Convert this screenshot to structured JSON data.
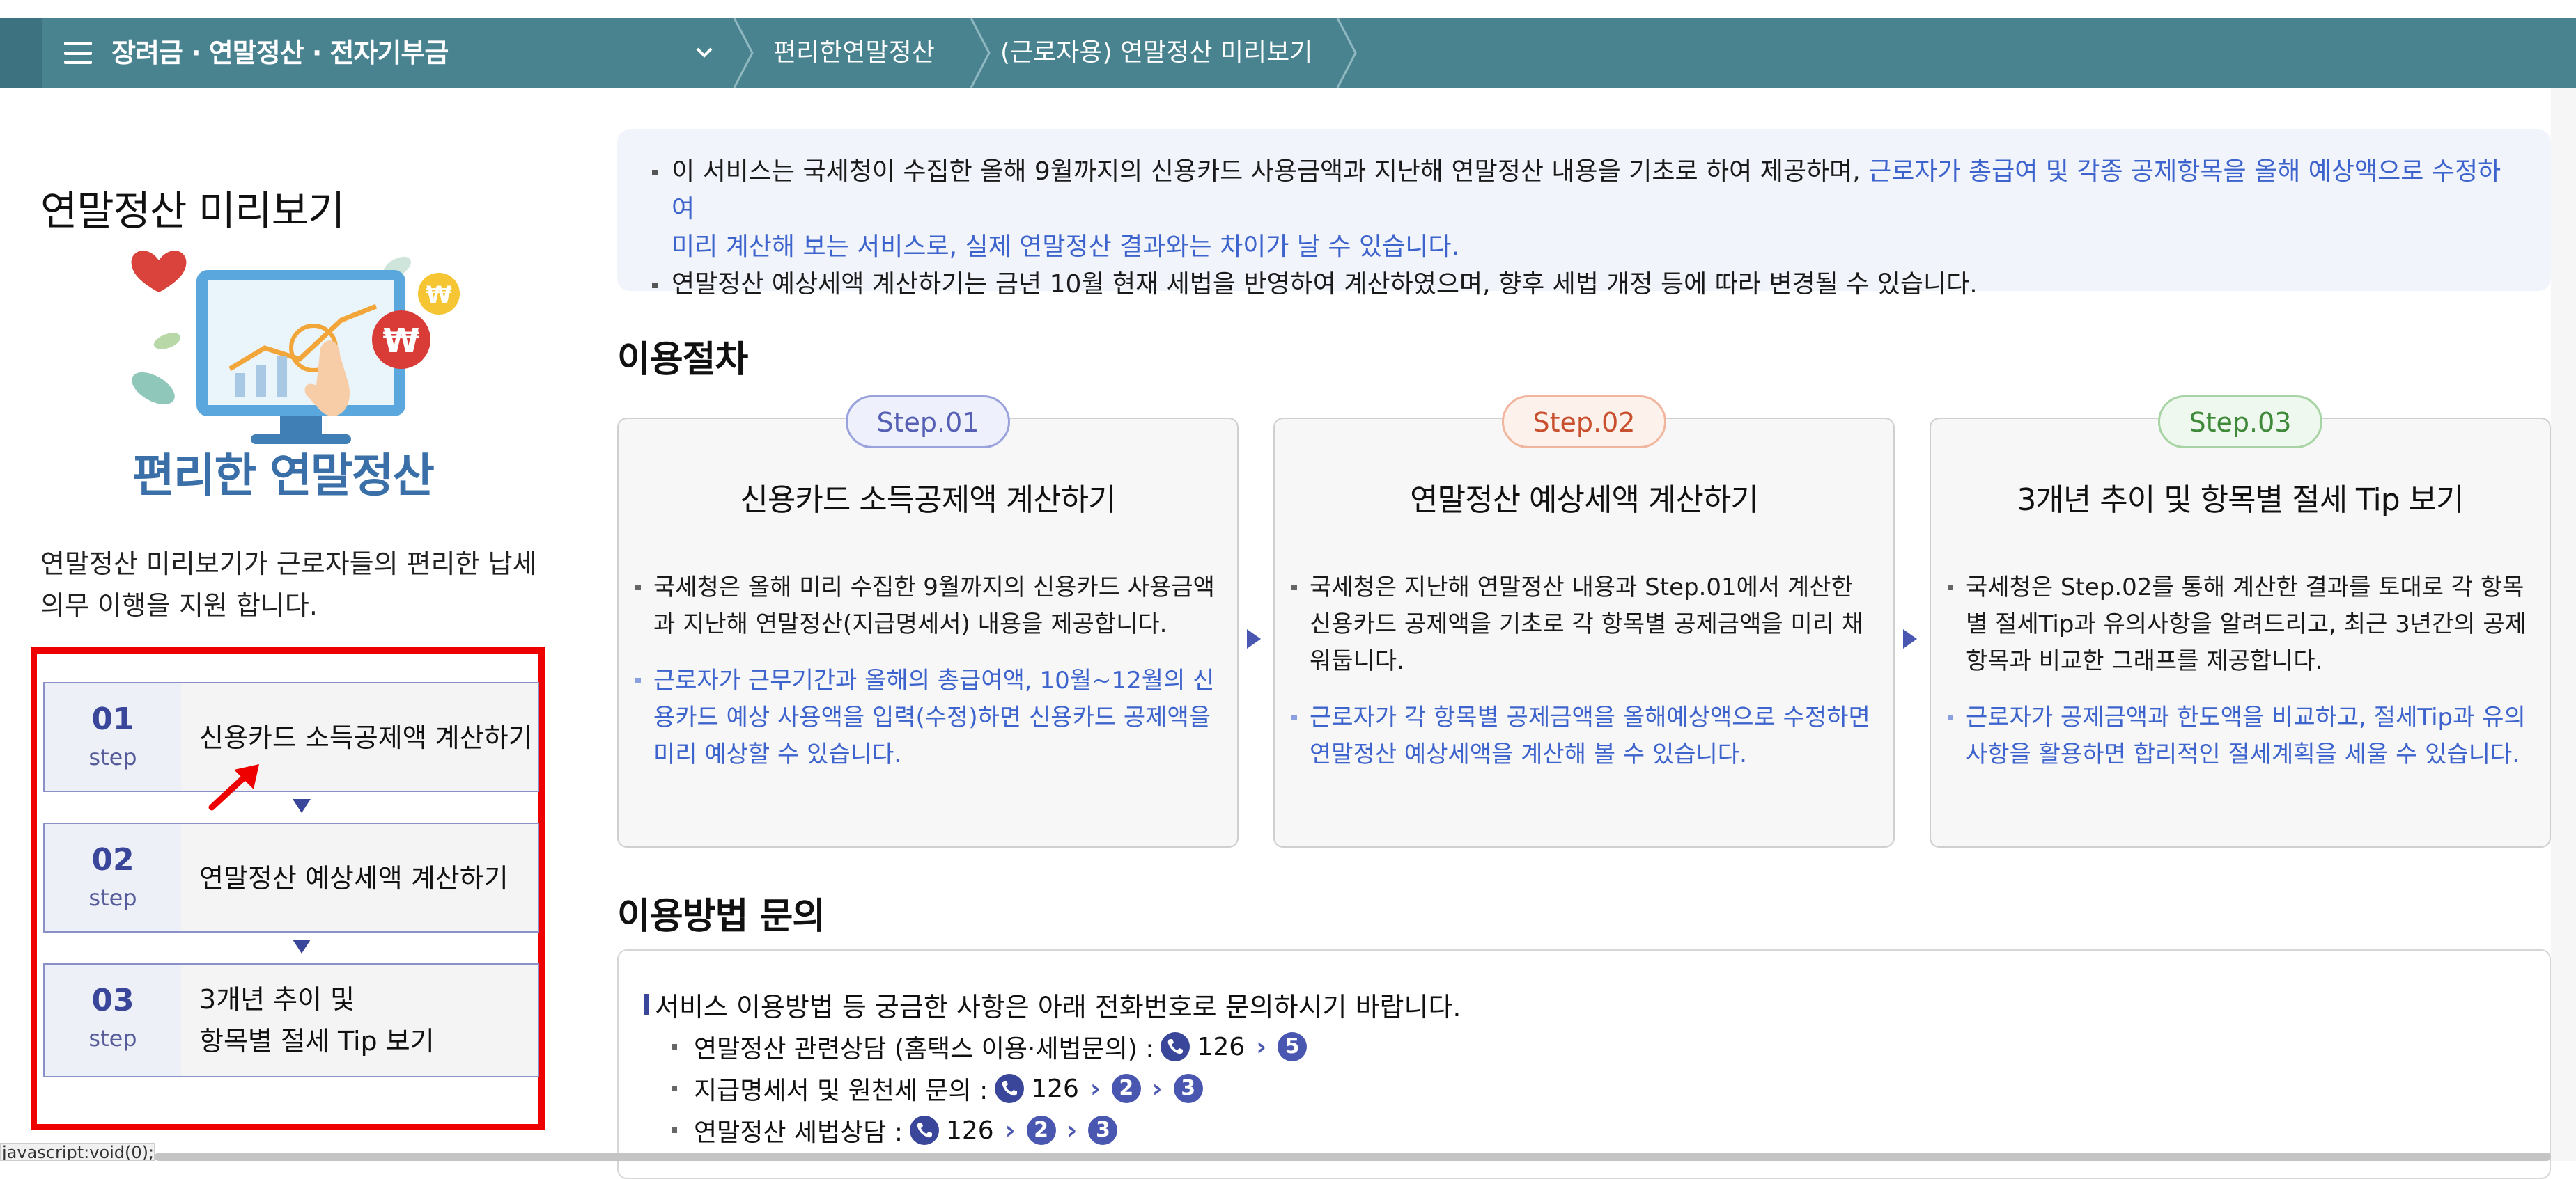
{
  "breadcrumb": {
    "level1": "장려금 · 연말정산 · 전자기부금",
    "level2": "편리한연말정산",
    "level3": "(근로자용) 연말정산 미리보기"
  },
  "left": {
    "title": "연말정산 미리보기",
    "illustration_caption": "편리한 연말정산",
    "description": "연말정산 미리보기가 근로자들의  편리한 납세 의무 이행을 지원 합니다.",
    "steps": [
      {
        "num": "01",
        "word": "step",
        "label": "신용카드 소득공제액 계산하기"
      },
      {
        "num": "02",
        "word": "step",
        "label": "연말정산 예상세액 계산하기"
      },
      {
        "num": "03",
        "word": "step",
        "label_line1": "3개년 추이 및",
        "label_line2": "항목별 절세 Tip 보기"
      }
    ]
  },
  "notice": {
    "line1_black": "이 서비스는 국세청이 수집한 올해 9월까지의 신용카드 사용금액과 지난해 연말정산 내용을 기초로 하여 제공하며, ",
    "line1_blue": "근로자가 총급여 및 각종 공제항목을 올해 예상액으로 수정하여",
    "line2_blue": "미리 계산해 보는 서비스로, 실제 연말정산 결과와는 차이가 날 수 있습니다.",
    "line3": "연말정산 예상세액 계산하기는 금년 10월 현재 세법을 반영하여 계산하였으며, 향후 세법 개정 등에 따라 변경될 수 있습니다."
  },
  "procedure": {
    "title": "이용절차",
    "cards": [
      {
        "pill": "Step.01",
        "pill_color": "#5560b5",
        "title": "신용카드 소득공제액 계산하기",
        "body_black": "국세청은 올해 미리 수집한 9월까지의 신용카드 사용금액과 지난해 연말정산(지급명세서) 내용을 제공합니다.",
        "body_blue": "근로자가 근무기간과 올해의 총급여액, 10월~12월의 신용카드 예상 사용액을 입력(수정)하면 신용카드 공제액을 미리 예상할 수 있습니다."
      },
      {
        "pill": "Step.02",
        "pill_color": "#c9502e",
        "title": "연말정산 예상세액 계산하기",
        "body_black": "국세청은 지난해 연말정산 내용과 Step.01에서 계산한 신용카드 공제액을 기초로 각 항목별 공제금액을 미리 채워둡니다.",
        "body_blue": "근로자가 각 항목별 공제금액을 올해예상액으로 수정하면 연말정산 예상세액을 계산해 볼 수 있습니다."
      },
      {
        "pill": "Step.03",
        "pill_color": "#3f8a3a",
        "title": "3개년 추이 및 항목별 절세 Tip 보기",
        "body_black": "국세청은 Step.02를 통해 계산한 결과를 토대로 각 항목별 절세Tip과 유의사항을 알려드리고, 최근 3년간의 공제항목과 비교한 그래프를 제공합니다.",
        "body_blue": "근로자가 공제금액과 한도액을 비교하고, 절세Tip과 유의사항을 활용하면 합리적인 절세계획을 세울 수 있습니다."
      }
    ]
  },
  "inquiry": {
    "title": "이용방법 문의",
    "intro": "서비스 이용방법 등 궁금한 사항은 아래 전화번호로 문의하시기 바랍니다.",
    "rows": [
      {
        "label": "연말정산 관련상담 (홈택스 이용·세법문의) :",
        "phone": "126",
        "keys": [
          "5"
        ]
      },
      {
        "label": "지급명세서 및 원천세 문의 :",
        "phone": "126",
        "keys": [
          "2",
          "3"
        ]
      },
      {
        "label": "연말정산 세법상담 :",
        "phone": "126",
        "keys": [
          "2",
          "3"
        ]
      }
    ]
  },
  "status_bar": {
    "text": "javascript:void(0);"
  },
  "colors": {
    "topbar": "#4a8390",
    "accent_blue": "#3d63cc",
    "step_navy": "#3a4699",
    "highlight_red": "#ee0000"
  }
}
